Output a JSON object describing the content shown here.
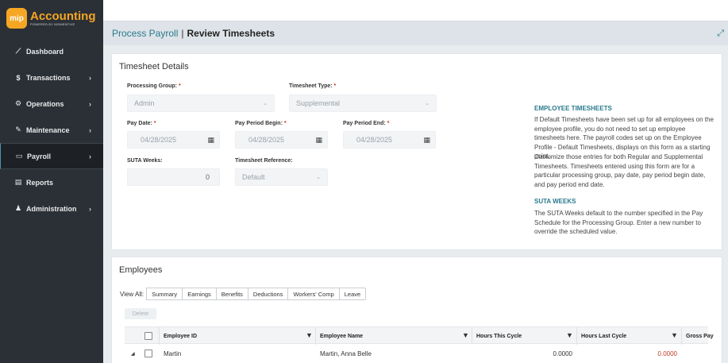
{
  "brand": {
    "badge": "mip",
    "title": "Accounting",
    "subtitle": "POWERED BY MOMENTIVE"
  },
  "nav": [
    {
      "icon": "📈",
      "label": "Dashboard",
      "has_chevron": false
    },
    {
      "icon": "$",
      "label": "Transactions",
      "has_chevron": true
    },
    {
      "icon": "⚙",
      "label": "Operations",
      "has_chevron": true
    },
    {
      "icon": "🔧",
      "label": "Maintenance",
      "has_chevron": true
    },
    {
      "icon": "💳",
      "label": "Payroll",
      "has_chevron": true,
      "active": true
    },
    {
      "icon": "🗎",
      "label": "Reports",
      "has_chevron": false
    },
    {
      "icon": "👥",
      "label": "Administration",
      "has_chevron": true
    }
  ],
  "breadcrumb": {
    "parent": "Process Payroll",
    "separator": "|",
    "current": "Review Timesheets"
  },
  "details": {
    "title": "Timesheet Details",
    "processing_group_label": "Processing Group:",
    "processing_group_value": "Admin",
    "timesheet_type_label": "Timesheet Type:",
    "timesheet_type_value": "Supplemental",
    "pay_date_label": "Pay Date:",
    "pay_date_value": "04/28/2025",
    "period_begin_label": "Pay Period Begin:",
    "period_begin_value": "04/28/2025",
    "period_end_label": "Pay Period End:",
    "period_end_value": "04/28/2025",
    "suta_weeks_label": "SUTA Weeks:",
    "suta_weeks_value": "0",
    "timesheet_ref_label": "Timesheet Reference:",
    "timesheet_ref_value": "Default",
    "required_mark": "*"
  },
  "help": {
    "title1": "EMPLOYEE TIMESHEETS",
    "text1": "If Default Timesheets have been set up for all employees on the employee profile, you do not need to set up employee timesheets here. The payroll codes set up on the Employee Profile - Default Timesheets, displays on this form as a starting point.",
    "text2": "Customize those entries for both Regular and Supplemental Timesheets. Timesheets entered using this form are for a particular processing group, pay date, pay period begin date, and pay period end date.",
    "title2": "SUTA WEEKS",
    "text3": "The SUTA Weeks default to the number specified in the Pay Schedule for the Processing Group. Enter a new number to override the scheduled value."
  },
  "employees": {
    "title": "Employees",
    "view_all_label": "View All:",
    "view_buttons": [
      "Summary",
      "Earnings",
      "Benefits",
      "Deductions",
      "Workers' Comp",
      "Leave"
    ],
    "delete_label": "Delete",
    "columns": [
      "Employee ID",
      "Employee Name",
      "Hours This Cycle",
      "Hours Last Cycle",
      "Gross Pay"
    ],
    "rows": [
      {
        "employee_id": "Martin",
        "employee_name": "Martin, Anna Belle",
        "hours_this_cycle": "0.0000",
        "hours_last_cycle": "0.0000"
      }
    ]
  },
  "colors": {
    "accent": "#2a7a8c",
    "sidebar": "#2b3036",
    "brand_orange": "#f5a623",
    "required": "#c0392b"
  }
}
